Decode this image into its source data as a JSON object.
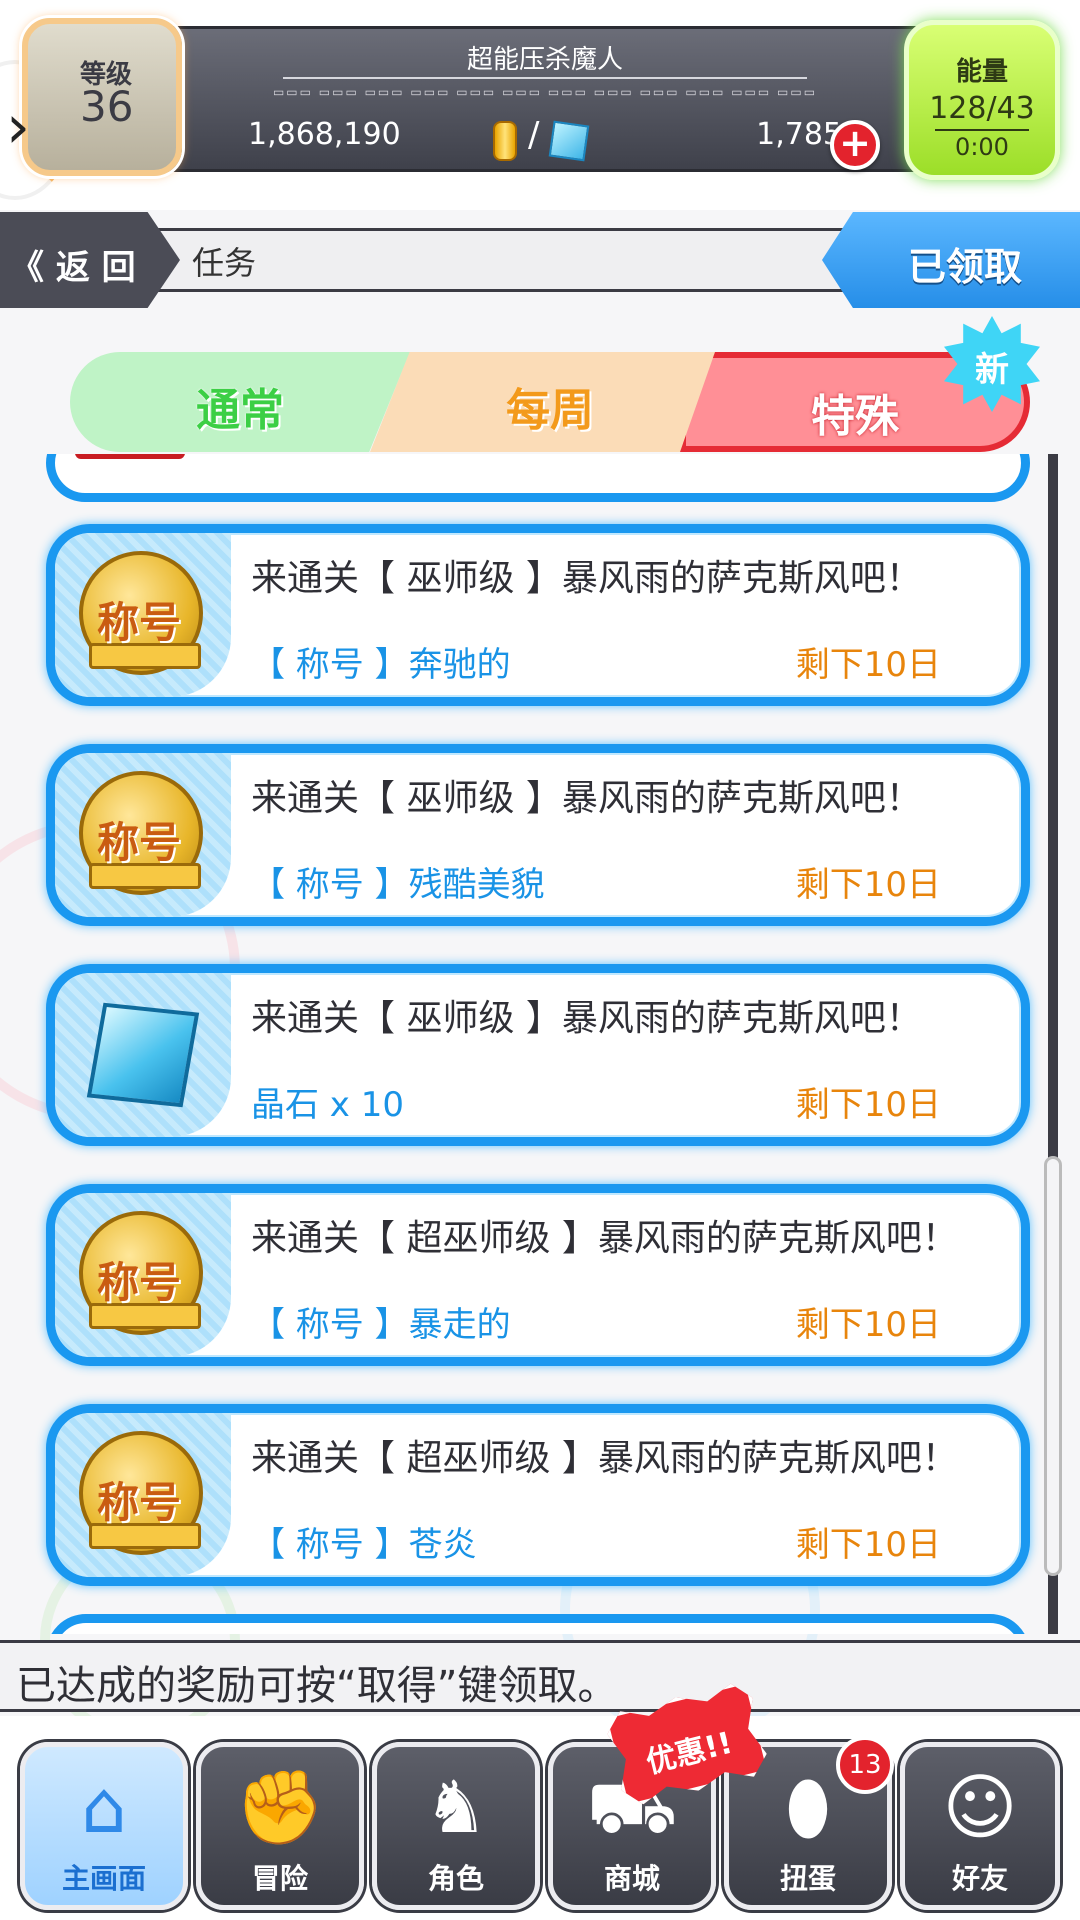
{
  "header": {
    "player_name": "超能压杀魔人",
    "player_subtitle": "▭▭▭ ▭▭▭ ▭▭▭ ▭▭▭ ▭▭▭ ▭▭▭ ▭▭▭ ▭▭▭ ▭▭▭ ▭▭▭ ▭▭▭ ▭▭▭",
    "level_label": "等级",
    "level_value": "36",
    "coins": "1,868,190",
    "currency_separator": "/",
    "gems": "1,785",
    "add_currency": "+",
    "side_arrow": "›",
    "energy_label": "能量",
    "energy_value": "128/43",
    "energy_timer": "0:00"
  },
  "nav_bar": {
    "back_label": "《 返 回",
    "page_title": "任务",
    "claimed_label": "已领取"
  },
  "tabs": [
    {
      "label": "通常",
      "active": false
    },
    {
      "label": "每周",
      "active": false
    },
    {
      "label": "特殊",
      "active": true
    }
  ],
  "tabs_new_badge": "新",
  "partial_top_icon_label": "等级",
  "quests": [
    {
      "icon": "title-medal-icon",
      "icon_text": "称号",
      "description": "来通关【 巫师级 】暴风雨的萨克斯风吧！",
      "reward": "【 称号 】奔驰的",
      "remaining": "剩下10日"
    },
    {
      "icon": "title-medal-icon",
      "icon_text": "称号",
      "description": "来通关【 巫师级 】暴风雨的萨克斯风吧！",
      "reward": "【 称号 】残酷美貌",
      "remaining": "剩下10日"
    },
    {
      "icon": "crystal-gem-icon",
      "icon_text": "",
      "description": "来通关【 巫师级 】暴风雨的萨克斯风吧！",
      "reward": "晶石 x 10",
      "remaining": "剩下10日"
    },
    {
      "icon": "title-medal-icon",
      "icon_text": "称号",
      "description": "来通关【 超巫师级 】暴风雨的萨克斯风吧！",
      "reward": "【 称号 】暴走的",
      "remaining": "剩下10日"
    },
    {
      "icon": "title-medal-icon",
      "icon_text": "称号",
      "description": "来通关【 超巫师级 】暴风雨的萨克斯风吧！",
      "reward": "【 称号 】苍炎",
      "remaining": "剩下10日"
    }
  ],
  "hint": "已达成的奖励可按“取得”键领取。",
  "bottom_nav": {
    "home": "主画面",
    "adventure": "冒险",
    "character": "角色",
    "shop": "商城",
    "gacha": "扭蛋",
    "friends": "好友",
    "sale_label": "优惠!!",
    "gacha_count": "13"
  },
  "colors": {
    "accent_blue": "#1a98f0",
    "remaining_orange": "#e8850c",
    "special_tab_red": "#e52b35",
    "energy_green": "#9cde28"
  }
}
